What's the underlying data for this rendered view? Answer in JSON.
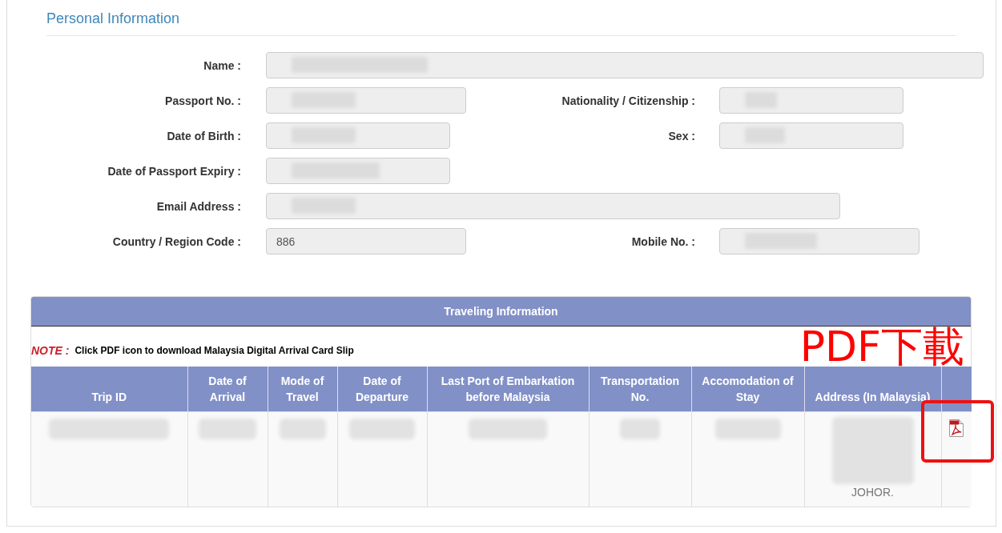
{
  "personal_information": {
    "title": "Personal Information",
    "rows": [
      [
        {
          "label": "Name :",
          "disabled": true,
          "redacted": true
        }
      ],
      [
        {
          "label": "Passport No. :",
          "disabled": true,
          "redacted": true
        },
        {
          "label": "Nationality / Citizenship :",
          "disabled": true,
          "redacted": true
        }
      ],
      [
        {
          "label": "Date of Birth :",
          "disabled": true,
          "redacted": true
        },
        {
          "label": "Sex :",
          "disabled": true,
          "redacted": true
        }
      ],
      [
        {
          "label": "Date of Passport Expiry :",
          "disabled": true,
          "redacted": true
        }
      ],
      [
        {
          "label": "Email Address :",
          "disabled": true,
          "redacted": true
        }
      ],
      [
        {
          "label": "Country / Region Code :",
          "value": "886",
          "disabled": true,
          "redacted": false
        },
        {
          "label": "Mobile No. :",
          "disabled": true,
          "redacted": true
        }
      ]
    ]
  },
  "traveling_information": {
    "title": "Traveling Information",
    "note": {
      "label": "NOTE :",
      "text": "Click PDF icon to download Malaysia Digital Arrival Card Slip"
    },
    "table": {
      "columns": [
        "Trip ID",
        "Date of Arrival",
        "Mode of Travel",
        "Date of Departure",
        "Last Port of Embarkation before Malaysia",
        "Transportation No.",
        "Accomodation of Stay",
        "Address (In Malaysia)"
      ],
      "rows": [
        {
          "cells": [
            {
              "redacted": true
            },
            {
              "redacted": true
            },
            {
              "redacted": true
            },
            {
              "redacted": true
            },
            {
              "redacted": true
            },
            {
              "redacted": true
            },
            {
              "redacted": true
            },
            {
              "text": "JOHOR.",
              "redacted": true
            }
          ],
          "pdf_link": true
        }
      ]
    }
  },
  "annotation": {
    "text": "PDF下載",
    "highlight": true
  }
}
